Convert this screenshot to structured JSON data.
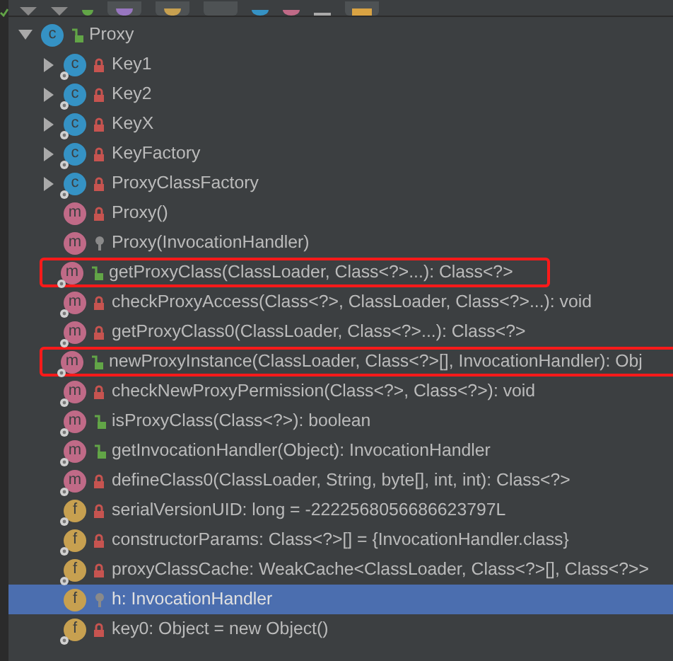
{
  "tree": {
    "label": "Proxy",
    "kind": "class",
    "letter": "c",
    "public": true,
    "private": false,
    "static": false,
    "expanded": true,
    "selected": false,
    "annotated": false,
    "children": [
      {
        "label": "Key1",
        "kind": "class",
        "letter": "c",
        "public": false,
        "private": true,
        "static": true,
        "expanded": false,
        "selected": false,
        "annotated": false
      },
      {
        "label": "Key2",
        "kind": "class",
        "letter": "c",
        "public": false,
        "private": true,
        "static": true,
        "expanded": false,
        "selected": false,
        "annotated": false
      },
      {
        "label": "KeyX",
        "kind": "class",
        "letter": "c",
        "public": false,
        "private": true,
        "static": true,
        "expanded": false,
        "selected": false,
        "annotated": false
      },
      {
        "label": "KeyFactory",
        "kind": "class",
        "letter": "c",
        "public": false,
        "private": true,
        "static": true,
        "expanded": false,
        "selected": false,
        "annotated": false
      },
      {
        "label": "ProxyClassFactory",
        "kind": "class",
        "letter": "c",
        "public": false,
        "private": true,
        "static": true,
        "expanded": false,
        "selected": false,
        "annotated": false
      },
      {
        "label": "Proxy()",
        "kind": "method",
        "letter": "m",
        "public": false,
        "private": true,
        "static": false,
        "selected": false,
        "annotated": false
      },
      {
        "label": "Proxy(InvocationHandler)",
        "kind": "method",
        "letter": "m",
        "public": false,
        "private": false,
        "static": false,
        "selected": false,
        "annotated": false
      },
      {
        "label": "getProxyClass(ClassLoader, Class<?>...): Class<?>",
        "kind": "method",
        "letter": "m",
        "public": true,
        "private": false,
        "static": true,
        "selected": false,
        "annotated": true
      },
      {
        "label": "checkProxyAccess(Class<?>, ClassLoader, Class<?>...): void",
        "kind": "method",
        "letter": "m",
        "public": false,
        "private": true,
        "static": true,
        "selected": false,
        "annotated": false
      },
      {
        "label": "getProxyClass0(ClassLoader, Class<?>...): Class<?>",
        "kind": "method",
        "letter": "m",
        "public": false,
        "private": true,
        "static": true,
        "selected": false,
        "annotated": false
      },
      {
        "label": "newProxyInstance(ClassLoader, Class<?>[], InvocationHandler): Obj",
        "kind": "method",
        "letter": "m",
        "public": true,
        "private": false,
        "static": true,
        "selected": false,
        "annotated": true
      },
      {
        "label": "checkNewProxyPermission(Class<?>, Class<?>): void",
        "kind": "method",
        "letter": "m",
        "public": false,
        "private": true,
        "static": true,
        "selected": false,
        "annotated": false
      },
      {
        "label": "isProxyClass(Class<?>): boolean",
        "kind": "method",
        "letter": "m",
        "public": true,
        "private": false,
        "static": true,
        "selected": false,
        "annotated": false
      },
      {
        "label": "getInvocationHandler(Object): InvocationHandler",
        "kind": "method",
        "letter": "m",
        "public": true,
        "private": false,
        "static": true,
        "selected": false,
        "annotated": false
      },
      {
        "label": "defineClass0(ClassLoader, String, byte[], int, int): Class<?>",
        "kind": "method",
        "letter": "m",
        "public": false,
        "private": true,
        "static": true,
        "selected": false,
        "annotated": false
      },
      {
        "label": "serialVersionUID: long = -2222568056686623797L",
        "kind": "field",
        "letter": "f",
        "public": false,
        "private": true,
        "static": true,
        "selected": false,
        "annotated": false
      },
      {
        "label": "constructorParams: Class<?>[] = {InvocationHandler.class}",
        "kind": "field",
        "letter": "f",
        "public": false,
        "private": true,
        "static": true,
        "selected": false,
        "annotated": false
      },
      {
        "label": "proxyClassCache: WeakCache<ClassLoader, Class<?>[], Class<?>>",
        "kind": "field",
        "letter": "f",
        "public": false,
        "private": true,
        "static": true,
        "selected": false,
        "annotated": false
      },
      {
        "label": "h: InvocationHandler",
        "kind": "field",
        "letter": "f",
        "public": false,
        "private": false,
        "static": false,
        "selected": true,
        "annotated": false
      },
      {
        "label": "key0: Object = new Object()",
        "kind": "field",
        "letter": "f",
        "public": false,
        "private": true,
        "static": true,
        "selected": false,
        "annotated": false
      }
    ]
  }
}
